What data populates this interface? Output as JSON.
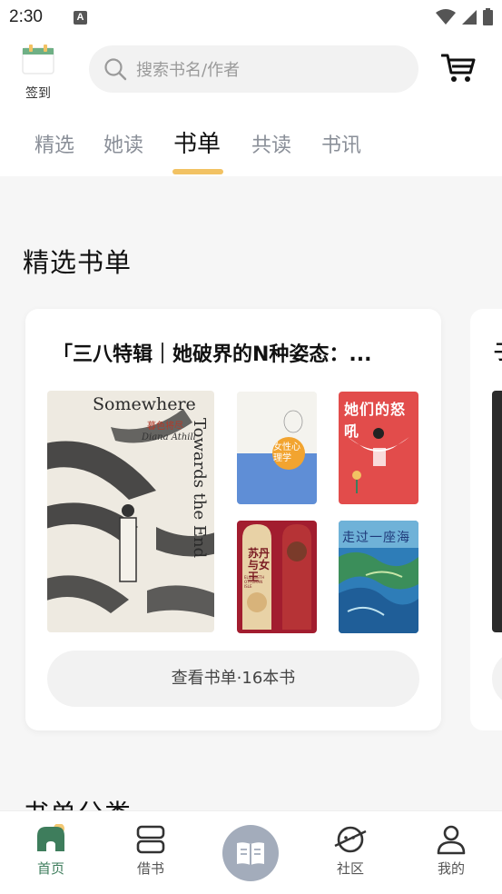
{
  "status_bar": {
    "time": "2:30",
    "notif": "A"
  },
  "header": {
    "checkin_label": "签到",
    "search_placeholder": "搜索书名/作者"
  },
  "tabs": [
    {
      "label": "精选"
    },
    {
      "label": "她读"
    },
    {
      "label": "书单"
    },
    {
      "label": "共读"
    },
    {
      "label": "书讯"
    }
  ],
  "active_tab": "书单",
  "section": {
    "title": "精选书单",
    "card": {
      "title": "「三八特辑｜她破界的N种姿态：...",
      "view_label": "查看书单·16本书",
      "books": [
        {
          "title": "Somewhere",
          "subtitle": "Towards the End",
          "cn": "暮色将尽",
          "author": "Diana Athill"
        },
        {
          "cn": "女性心理学"
        },
        {
          "cn": "她们的怒吼"
        },
        {
          "cn": "苏丹与女王",
          "en": "ELIZABETH OTTOMAN ISLE"
        },
        {
          "cn": "走过一座海"
        }
      ]
    },
    "next_card_title": "子"
  },
  "section2_title": "书单分类",
  "bottom_nav": [
    {
      "label": "首页"
    },
    {
      "label": "借书"
    },
    {
      "label": ""
    },
    {
      "label": "社区"
    },
    {
      "label": "我的"
    }
  ]
}
